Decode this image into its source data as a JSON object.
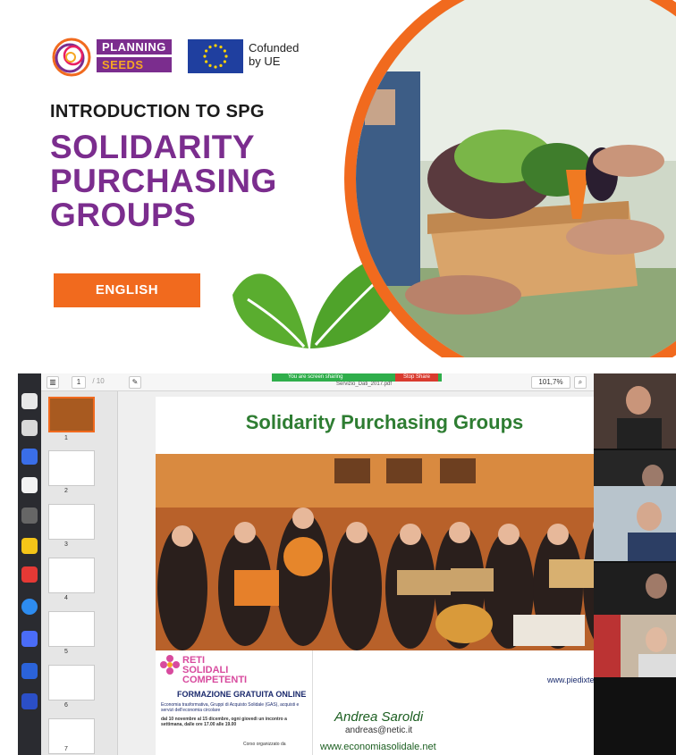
{
  "banner": {
    "brand": {
      "line1": "PLANNING",
      "line2": "SEEDS"
    },
    "cofund": {
      "line1": "Cofunded",
      "line2": "by UE"
    },
    "intro": "INTRODUCTION TO SPG",
    "title_lines": [
      "SOLIDARITY",
      "PURCHASING",
      "GROUPS"
    ],
    "language_button": "ENGLISH",
    "colors": {
      "purple": "#7b2d8e",
      "orange": "#f16a1e",
      "green": "#4caf50"
    }
  },
  "call": {
    "toolbar": {
      "page_number": "1",
      "page_total": "/ 10",
      "zoom": "101,7%",
      "sharing_text": "You are screen sharing",
      "stop_share": "Stop Share",
      "file_name": "Servizio_Dati_2017.pdf"
    },
    "thumbnail_numbers": [
      "1",
      "2",
      "3",
      "4",
      "5",
      "6",
      "7"
    ],
    "slide": {
      "title": "Solidarity Purchasing Groups",
      "photo_url": "www.piedixterra.",
      "poster": {
        "reti_line1": "RETI",
        "reti_line2": "SOLIDALI",
        "reti_line3": "COMPETENTI",
        "formazione": "FORMAZIONE GRATUITA ONLINE",
        "subtitle": "Economia trasformativa, Gruppi di Acquisto Solidale (GAS), acquisti e servizi dell'economia circolare",
        "dates": "dal 10 novembre al 15 dicembre, ogni giovedì un incontro a settimana, dalle ore 17.00 alle 19.00",
        "organized": "Corso organizzato da"
      },
      "author": "Andrea Saroldi",
      "email": "andreas@netic.it",
      "website": "www.economiasolidale.net"
    }
  }
}
